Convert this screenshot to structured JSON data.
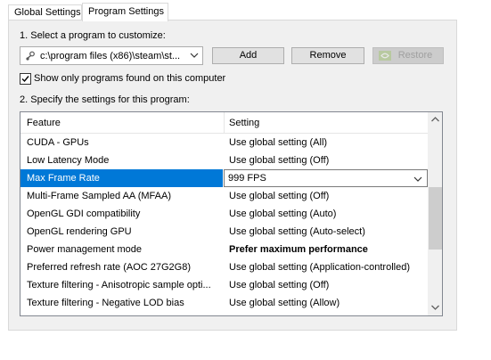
{
  "tabs": [
    {
      "label": "Global Settings",
      "active": false
    },
    {
      "label": "Program Settings",
      "active": true
    }
  ],
  "step1": {
    "label": "1. Select a program to customize:",
    "program_value": "c:\\program files (x86)\\steam\\st...",
    "add_label": "Add",
    "remove_label": "Remove",
    "restore_label": "Restore"
  },
  "filter": {
    "label": "Show only programs found on this computer",
    "checked": true
  },
  "step2": {
    "label": "2. Specify the settings for this program:"
  },
  "table": {
    "headers": [
      "Feature",
      "Setting"
    ],
    "rows": [
      {
        "feature": "CUDA - GPUs",
        "setting": "Use global setting (All)"
      },
      {
        "feature": "Low Latency Mode",
        "setting": "Use global setting (Off)"
      },
      {
        "feature": "Max Frame Rate",
        "setting": "999 FPS",
        "selected": true
      },
      {
        "feature": "Multi-Frame Sampled AA (MFAA)",
        "setting": "Use global setting (Off)"
      },
      {
        "feature": "OpenGL GDI compatibility",
        "setting": "Use global setting (Auto)"
      },
      {
        "feature": "OpenGL rendering GPU",
        "setting": "Use global setting (Auto-select)"
      },
      {
        "feature": "Power management mode",
        "setting": "Prefer maximum performance",
        "bold": true
      },
      {
        "feature": "Preferred refresh rate (AOC 27G2G8)",
        "setting": "Use global setting (Application-controlled)"
      },
      {
        "feature": "Texture filtering - Anisotropic sample opti...",
        "setting": "Use global setting (Off)"
      },
      {
        "feature": "Texture filtering - Negative LOD bias",
        "setting": "Use global setting (Allow)"
      }
    ]
  },
  "colors": {
    "selection": "#0078d7",
    "panel": "#f0f0f0",
    "nvidia_green": "#76b900"
  }
}
